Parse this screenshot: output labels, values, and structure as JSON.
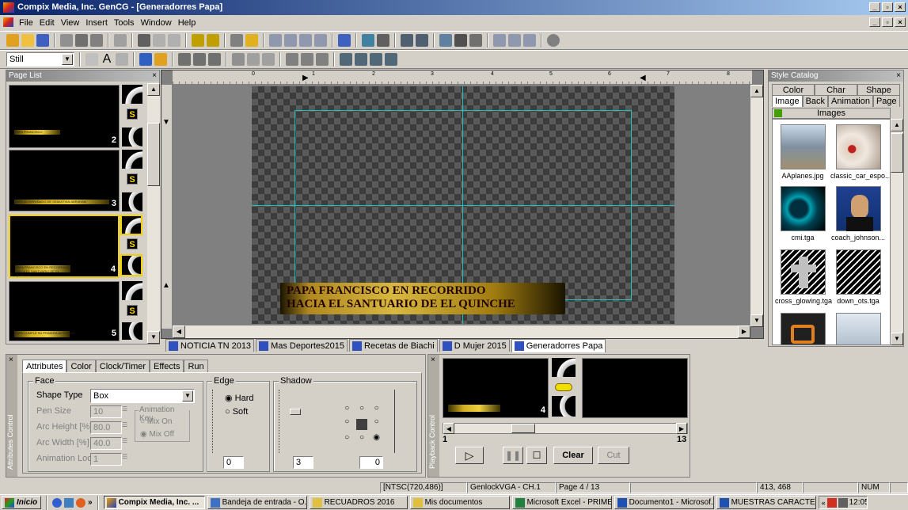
{
  "window": {
    "title": "Compix Media, Inc. GenCG - [Generadorres Papa]"
  },
  "menu": [
    "File",
    "Edit",
    "View",
    "Insert",
    "Tools",
    "Window",
    "Help"
  ],
  "toolbar2": {
    "mode": "Still",
    "text_tool": "A"
  },
  "page_list": {
    "title": "Page List",
    "pages": [
      {
        "num": "2",
        "caption": "PAPA FRANCISCO"
      },
      {
        "num": "3",
        "caption": "PAPA ACOMPAÑADO DE SEBASTIAN ABRAHAM"
      },
      {
        "num": "4",
        "caption": "PAPA FRANCISCO EN RECORRIDO HACIA EL SANTUARIO DE EL QUINCHE"
      },
      {
        "num": "5",
        "caption": "PAPA CUMPLE SU PRIMERA ACTIVIDAD"
      }
    ],
    "s_label": "S"
  },
  "ruler": [
    "0",
    "1",
    "2",
    "3",
    "4",
    "5",
    "6",
    "7",
    "8"
  ],
  "canvas": {
    "line1": "PAPA FRANCISCO EN RECORRIDO",
    "line2": "HACIA EL SANTUARIO DE EL QUINCHE"
  },
  "doc_tabs": [
    "NOTICIA TN 2013",
    "Mas Deportes2015",
    "Recetas de Biachi",
    "D Mujer 2015",
    "Generadorres Papa"
  ],
  "style_catalog": {
    "title": "Style Catalog",
    "tabs_top": [
      "Color",
      "Char",
      "Shape"
    ],
    "tabs_bottom": [
      "Image",
      "Back",
      "Animation",
      "Page"
    ],
    "folder": "Images",
    "images": [
      "AAplanes.jpg",
      "classic_car_espo...",
      "cmi.tga",
      "coach_johnson...",
      "cross_glowing.tga",
      "down_ots.tga"
    ]
  },
  "attributes": {
    "tabs": [
      "Attributes",
      "Color",
      "Clock/Timer",
      "Effects",
      "Run"
    ],
    "side_caption": "Attributes Control",
    "face_label": "Face",
    "shape_type_label": "Shape Type",
    "shape_type": "Box",
    "pen_size_label": "Pen Size",
    "pen_size": "10",
    "arc_height_label": "Arc Height [%]",
    "arc_height": "80.0",
    "arc_width_label": "Arc Width [%]",
    "arc_width": "40.0",
    "anim_loop_label": "Animation Loop",
    "anim_loop": "1",
    "anim_key_label": "Animation Key",
    "mix_on": "Mix On",
    "mix_off": "Mix Off",
    "edge_label": "Edge",
    "hard": "Hard",
    "soft": "Soft",
    "edge_value": "0",
    "shadow_label": "Shadow",
    "shadow_value": "3",
    "shadow_value2": "0"
  },
  "playback": {
    "side_caption": "Playback Control",
    "page_num": "4",
    "range_start": "1",
    "range_end": "13",
    "clear": "Clear",
    "cut": "Cut"
  },
  "status": {
    "format": "[NTSC(720,486)]",
    "genlock": "GenlockVGA - CH.1",
    "page": "Page 4 / 13",
    "coords": "413, 468",
    "num": "NUM"
  },
  "taskbar": {
    "start": "Inicio",
    "tasks": [
      "Compix Media, Inc. ...",
      "Bandeja de entrada - O...",
      "RECUADROS 2016",
      "Mis documentos",
      "Microsoft Excel - PRIME...",
      "Documento1 - Microsof...",
      "MUESTRAS CARACTER..."
    ],
    "clock": "12:05"
  }
}
